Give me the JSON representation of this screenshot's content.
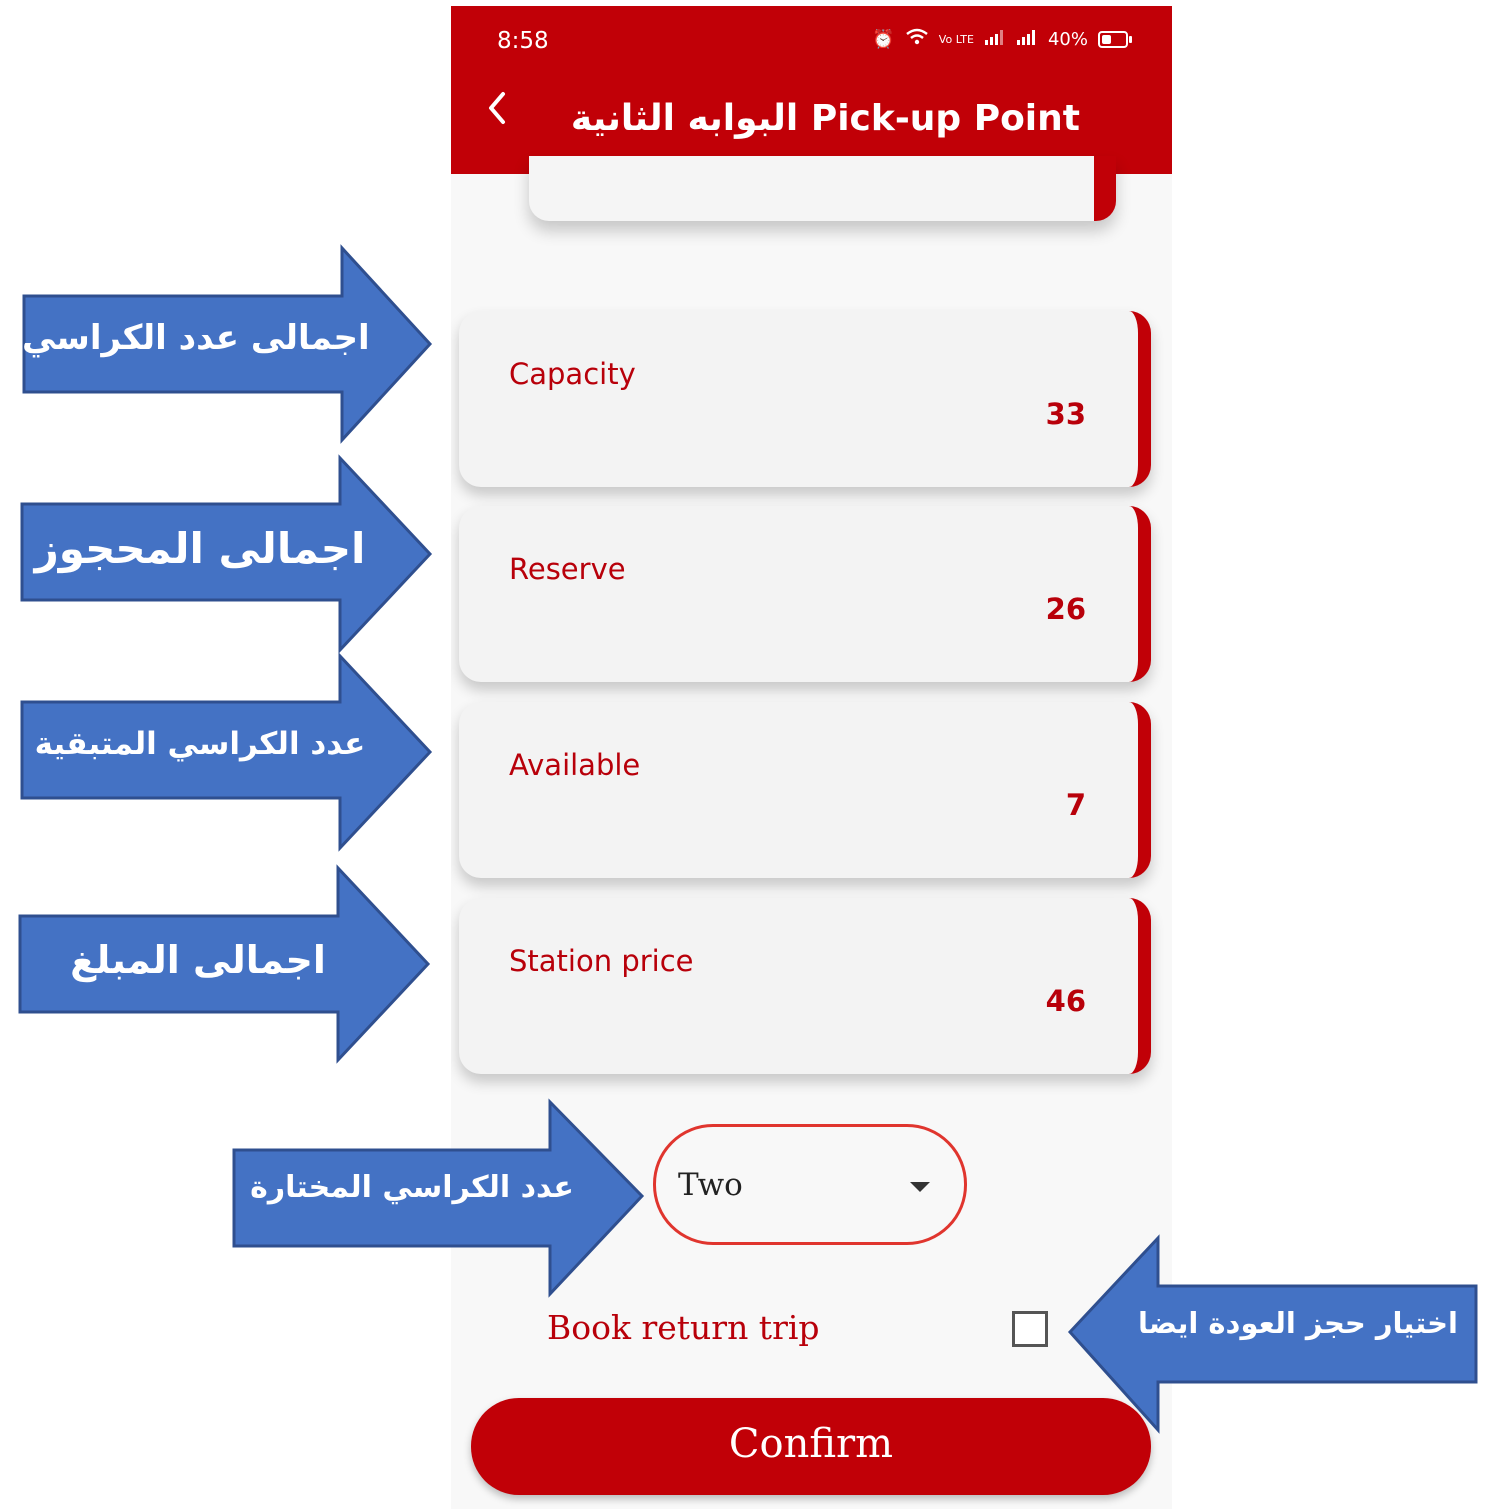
{
  "status_bar": {
    "time": "8:58",
    "network": "Vo LTE",
    "battery": "40%"
  },
  "header": {
    "title": "البوابه الثانية Pick-up Point"
  },
  "cards": [
    {
      "label": "Capacity",
      "value": "33"
    },
    {
      "label": "Reserve",
      "value": "26"
    },
    {
      "label": "Available",
      "value": "7"
    },
    {
      "label": "Station price",
      "value": "46"
    }
  ],
  "seat_select": {
    "value": "Two"
  },
  "return_trip": {
    "label": "Book return trip"
  },
  "confirm": {
    "label": "Confirm"
  },
  "annotations": [
    "اجمالى عدد الكراسي",
    "اجمالى المحجوز",
    "عدد الكراسي المتبقية",
    "اجمالى المبلغ",
    "عدد الكراسي المختارة",
    "اختيار حجز العودة ايضا"
  ],
  "colors": {
    "primary": "#c10007",
    "text_red": "#b8000a",
    "arrow_blue": "#4472c4",
    "arrow_border": "#2f4f8f"
  }
}
